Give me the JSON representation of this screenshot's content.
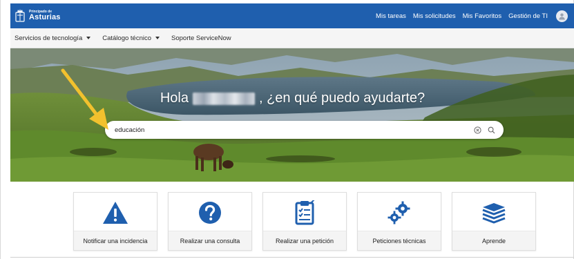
{
  "brand": {
    "small": "Principado de",
    "big": "Asturias"
  },
  "topnav": {
    "items": [
      "Mis tareas",
      "Mis solicitudes",
      "Mis Favoritos",
      "Gestión de TI"
    ]
  },
  "subnav": {
    "items": [
      {
        "label": "Servicios de tecnología",
        "dropdown": true
      },
      {
        "label": "Catálogo técnico",
        "dropdown": true
      },
      {
        "label": "Soporte ServiceNow",
        "dropdown": false
      }
    ]
  },
  "hero": {
    "greeting_pre": "Hola",
    "greeting_post": ", ¿en qué puedo ayudarte?"
  },
  "search": {
    "value": "educación"
  },
  "cards": [
    {
      "label": "Notificar una incidencia",
      "icon": "warning-icon"
    },
    {
      "label": "Realizar una consulta",
      "icon": "question-icon"
    },
    {
      "label": "Realizar una petición",
      "icon": "clipboard-icon"
    },
    {
      "label": "Peticiones técnicas",
      "icon": "gears-icon"
    },
    {
      "label": "Aprende",
      "icon": "books-icon"
    }
  ],
  "colors": {
    "topbar": "#1f5fae",
    "accent_icon": "#1f5fae",
    "arrow": "#f2c12e"
  }
}
